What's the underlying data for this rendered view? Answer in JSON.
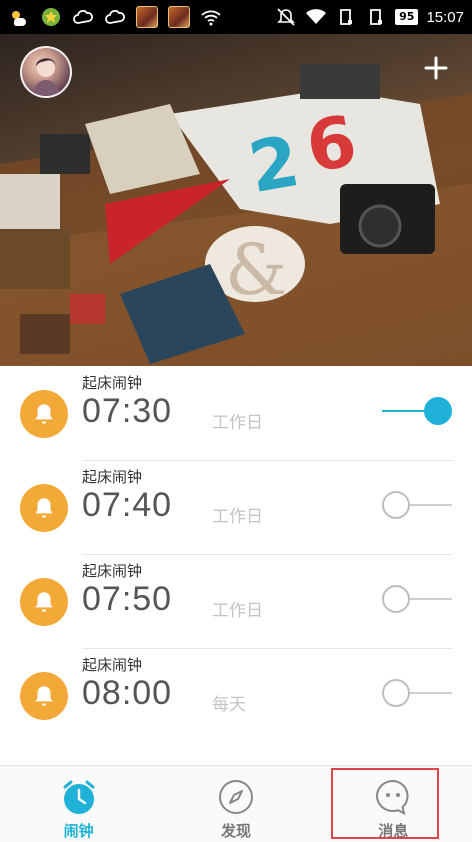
{
  "status_bar": {
    "battery": "95",
    "time": "15:07"
  },
  "hero": {
    "add_icon": "plus-icon",
    "avatar_icon": "user-avatar"
  },
  "alarms": [
    {
      "name": "起床闹钟",
      "time": "07:30",
      "repeat": "工作日",
      "enabled": true
    },
    {
      "name": "起床闹钟",
      "time": "07:40",
      "repeat": "工作日",
      "enabled": false
    },
    {
      "name": "起床闹钟",
      "time": "07:50",
      "repeat": "工作日",
      "enabled": false
    },
    {
      "name": "起床闹钟",
      "time": "08:00",
      "repeat": "每天",
      "enabled": false
    }
  ],
  "nav": {
    "items": [
      {
        "label": "闹钟",
        "icon": "alarm-clock-icon",
        "active": true
      },
      {
        "label": "发现",
        "icon": "compass-icon",
        "active": false
      },
      {
        "label": "消息",
        "icon": "chat-bubble-icon",
        "active": false
      }
    ]
  },
  "colors": {
    "accent": "#1fb1d8",
    "bell": "#f3a938",
    "highlight": "#e0434a"
  }
}
